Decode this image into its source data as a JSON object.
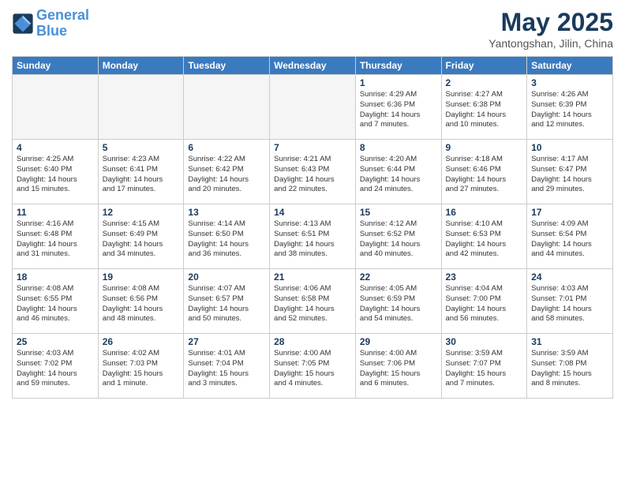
{
  "logo": {
    "line1": "General",
    "line2": "Blue"
  },
  "title": "May 2025",
  "subtitle": "Yantongshan, Jilin, China",
  "weekdays": [
    "Sunday",
    "Monday",
    "Tuesday",
    "Wednesday",
    "Thursday",
    "Friday",
    "Saturday"
  ],
  "weeks": [
    [
      {
        "day": "",
        "info": ""
      },
      {
        "day": "",
        "info": ""
      },
      {
        "day": "",
        "info": ""
      },
      {
        "day": "",
        "info": ""
      },
      {
        "day": "1",
        "info": "Sunrise: 4:29 AM\nSunset: 6:36 PM\nDaylight: 14 hours\nand 7 minutes."
      },
      {
        "day": "2",
        "info": "Sunrise: 4:27 AM\nSunset: 6:38 PM\nDaylight: 14 hours\nand 10 minutes."
      },
      {
        "day": "3",
        "info": "Sunrise: 4:26 AM\nSunset: 6:39 PM\nDaylight: 14 hours\nand 12 minutes."
      }
    ],
    [
      {
        "day": "4",
        "info": "Sunrise: 4:25 AM\nSunset: 6:40 PM\nDaylight: 14 hours\nand 15 minutes."
      },
      {
        "day": "5",
        "info": "Sunrise: 4:23 AM\nSunset: 6:41 PM\nDaylight: 14 hours\nand 17 minutes."
      },
      {
        "day": "6",
        "info": "Sunrise: 4:22 AM\nSunset: 6:42 PM\nDaylight: 14 hours\nand 20 minutes."
      },
      {
        "day": "7",
        "info": "Sunrise: 4:21 AM\nSunset: 6:43 PM\nDaylight: 14 hours\nand 22 minutes."
      },
      {
        "day": "8",
        "info": "Sunrise: 4:20 AM\nSunset: 6:44 PM\nDaylight: 14 hours\nand 24 minutes."
      },
      {
        "day": "9",
        "info": "Sunrise: 4:18 AM\nSunset: 6:46 PM\nDaylight: 14 hours\nand 27 minutes."
      },
      {
        "day": "10",
        "info": "Sunrise: 4:17 AM\nSunset: 6:47 PM\nDaylight: 14 hours\nand 29 minutes."
      }
    ],
    [
      {
        "day": "11",
        "info": "Sunrise: 4:16 AM\nSunset: 6:48 PM\nDaylight: 14 hours\nand 31 minutes."
      },
      {
        "day": "12",
        "info": "Sunrise: 4:15 AM\nSunset: 6:49 PM\nDaylight: 14 hours\nand 34 minutes."
      },
      {
        "day": "13",
        "info": "Sunrise: 4:14 AM\nSunset: 6:50 PM\nDaylight: 14 hours\nand 36 minutes."
      },
      {
        "day": "14",
        "info": "Sunrise: 4:13 AM\nSunset: 6:51 PM\nDaylight: 14 hours\nand 38 minutes."
      },
      {
        "day": "15",
        "info": "Sunrise: 4:12 AM\nSunset: 6:52 PM\nDaylight: 14 hours\nand 40 minutes."
      },
      {
        "day": "16",
        "info": "Sunrise: 4:10 AM\nSunset: 6:53 PM\nDaylight: 14 hours\nand 42 minutes."
      },
      {
        "day": "17",
        "info": "Sunrise: 4:09 AM\nSunset: 6:54 PM\nDaylight: 14 hours\nand 44 minutes."
      }
    ],
    [
      {
        "day": "18",
        "info": "Sunrise: 4:08 AM\nSunset: 6:55 PM\nDaylight: 14 hours\nand 46 minutes."
      },
      {
        "day": "19",
        "info": "Sunrise: 4:08 AM\nSunset: 6:56 PM\nDaylight: 14 hours\nand 48 minutes."
      },
      {
        "day": "20",
        "info": "Sunrise: 4:07 AM\nSunset: 6:57 PM\nDaylight: 14 hours\nand 50 minutes."
      },
      {
        "day": "21",
        "info": "Sunrise: 4:06 AM\nSunset: 6:58 PM\nDaylight: 14 hours\nand 52 minutes."
      },
      {
        "day": "22",
        "info": "Sunrise: 4:05 AM\nSunset: 6:59 PM\nDaylight: 14 hours\nand 54 minutes."
      },
      {
        "day": "23",
        "info": "Sunrise: 4:04 AM\nSunset: 7:00 PM\nDaylight: 14 hours\nand 56 minutes."
      },
      {
        "day": "24",
        "info": "Sunrise: 4:03 AM\nSunset: 7:01 PM\nDaylight: 14 hours\nand 58 minutes."
      }
    ],
    [
      {
        "day": "25",
        "info": "Sunrise: 4:03 AM\nSunset: 7:02 PM\nDaylight: 14 hours\nand 59 minutes."
      },
      {
        "day": "26",
        "info": "Sunrise: 4:02 AM\nSunset: 7:03 PM\nDaylight: 15 hours\nand 1 minute."
      },
      {
        "day": "27",
        "info": "Sunrise: 4:01 AM\nSunset: 7:04 PM\nDaylight: 15 hours\nand 3 minutes."
      },
      {
        "day": "28",
        "info": "Sunrise: 4:00 AM\nSunset: 7:05 PM\nDaylight: 15 hours\nand 4 minutes."
      },
      {
        "day": "29",
        "info": "Sunrise: 4:00 AM\nSunset: 7:06 PM\nDaylight: 15 hours\nand 6 minutes."
      },
      {
        "day": "30",
        "info": "Sunrise: 3:59 AM\nSunset: 7:07 PM\nDaylight: 15 hours\nand 7 minutes."
      },
      {
        "day": "31",
        "info": "Sunrise: 3:59 AM\nSunset: 7:08 PM\nDaylight: 15 hours\nand 8 minutes."
      }
    ]
  ]
}
